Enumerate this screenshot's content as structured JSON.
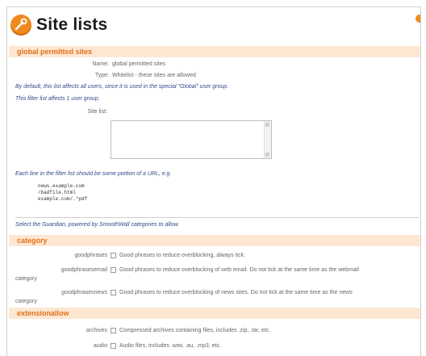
{
  "header": {
    "title": "Site lists",
    "icon": "tools-icon",
    "accent": "#f08a1e"
  },
  "global_section": {
    "heading": "global permitted sites",
    "name_label": "Name:",
    "name_value": "global permitted sites",
    "type_label": "Type:",
    "type_value": "Whitelist - these sites are allowed",
    "note_default": "By default, this list affects all users, since it is used in the special \"Global\" user group.",
    "note_affects": "This filter list affects 1 user group.",
    "site_list_label": "Site list:",
    "site_list_value": "",
    "note_each_line": "Each line in the filter list should be some portion of a URL, e.g.",
    "examples": [
      "news.example.com",
      "/badfile.html",
      "example.com/.*pdf"
    ],
    "note_select": "Select the Guardian, powered by SmoothWall categories to allow."
  },
  "category_section": {
    "heading": "category",
    "items": [
      {
        "name": "goodphrases",
        "checked": false,
        "desc": "Good phrases to reduce overblocking, always tick."
      },
      {
        "name": "goodphrasesemail",
        "checked": false,
        "desc": "Good phrases to reduce overblocking of web email. Do not tick at the same time as the webmail",
        "wrap": "category"
      },
      {
        "name": "goodphrasesnews",
        "checked": false,
        "desc": "Good phrases to reduce overblocking of news sites. Do not tick at the same time as the news",
        "wrap": "category"
      }
    ]
  },
  "extension_section": {
    "heading": "extensionallow",
    "items": [
      {
        "name": "archives",
        "checked": false,
        "desc": "Compressed archives containing files, includes .zip, .tar, etc."
      },
      {
        "name": "audio",
        "checked": false,
        "desc": "Audio files, includes .wav, .au, .mp3, etc."
      }
    ]
  }
}
